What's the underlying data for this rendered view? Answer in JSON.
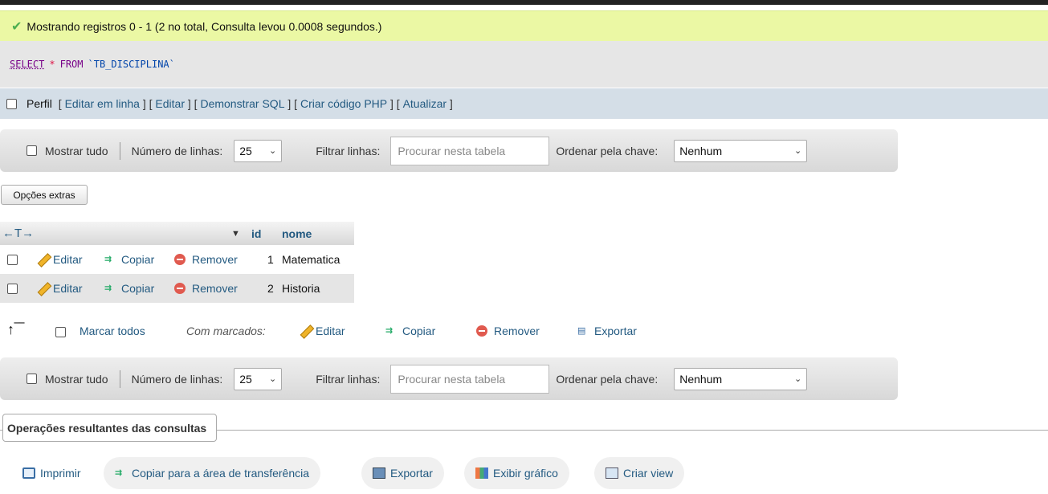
{
  "success": {
    "message": "Mostrando registros 0 - 1 (2 no total, Consulta levou 0.0008 segundos.)"
  },
  "sql": {
    "select": "SELECT",
    "star": "*",
    "from": "FROM",
    "table": "`TB_DISCIPLINA`"
  },
  "profile": {
    "label": "Perfil",
    "links": [
      "Editar em linha",
      "Editar",
      "Demonstrar SQL",
      "Criar código PHP",
      "Atualizar"
    ]
  },
  "nav": {
    "show_all": "Mostrar tudo",
    "rows_label": "Número de linhas:",
    "rows_value": "25",
    "filter_label": "Filtrar linhas:",
    "filter_placeholder": "Procurar nesta tabela",
    "sort_label": "Ordenar pela chave:",
    "sort_value": "Nenhum"
  },
  "extra_options": "Opções extras",
  "table": {
    "arrows": "←T→",
    "columns": [
      "id",
      "nome"
    ],
    "actions": {
      "edit": "Editar",
      "copy": "Copiar",
      "remove": "Remover"
    },
    "rows": [
      {
        "id": "1",
        "nome": "Matematica"
      },
      {
        "id": "2",
        "nome": "Historia"
      }
    ]
  },
  "bulk": {
    "check_all": "Marcar todos",
    "with_selected": "Com marcados:",
    "edit": "Editar",
    "copy": "Copiar",
    "remove": "Remover",
    "export": "Exportar"
  },
  "ops": {
    "title": "Operações resultantes das consultas",
    "print": "Imprimir",
    "copy_clipboard": "Copiar para a área de transferência",
    "export": "Exportar",
    "chart": "Exibir gráfico",
    "view": "Criar view"
  },
  "colors": {
    "success_bg": "#ebf8a4",
    "link": "#235a81",
    "profile_bg": "#d4dee7"
  }
}
